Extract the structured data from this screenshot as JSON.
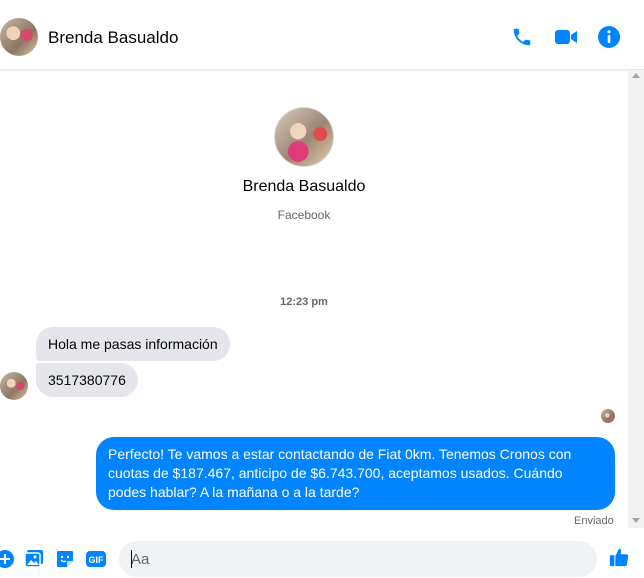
{
  "header": {
    "contact_name": "Brenda Basualdo"
  },
  "profile": {
    "name": "Brenda Basualdo",
    "source": "Facebook"
  },
  "conversation": {
    "timestamp": "12:23 pm",
    "incoming": [
      {
        "text": "Hola me pasas información"
      },
      {
        "text": "3517380776"
      }
    ],
    "outgoing": [
      {
        "text": "Perfecto! Te vamos a estar contactando de Fiat 0km. Tenemos Cronos con cuotas de $187.467, anticipo de $6.743.700, aceptamos usados. Cuándo podes hablar? A la mañana o a la tarde?"
      }
    ],
    "sent_status": "Enviado"
  },
  "composer": {
    "placeholder": "Aa",
    "gif_label": "GIF"
  },
  "colors": {
    "accent": "#0084ff",
    "incoming_bubble": "#e4e6eb",
    "emoji": "#f7b928"
  },
  "icons": {
    "header": [
      "phone-icon",
      "video-camera-icon",
      "info-icon"
    ],
    "composer": [
      "plus-icon",
      "image-icon",
      "sticker-icon",
      "gif-icon",
      "emoji-icon",
      "thumbs-up-icon"
    ]
  }
}
